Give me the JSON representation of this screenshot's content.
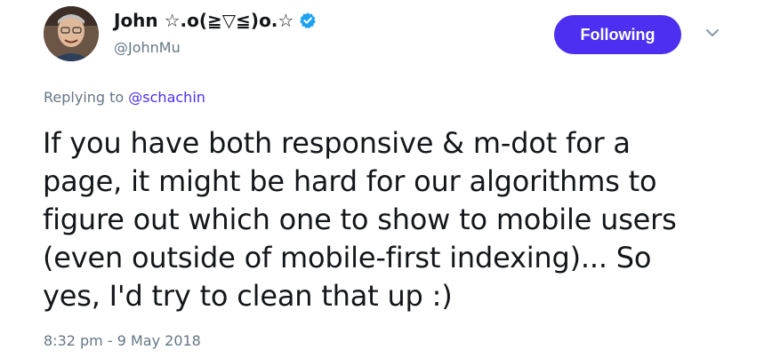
{
  "author": {
    "display_name": "John ☆.o(≧▽≦)o.☆",
    "handle": "@JohnMu",
    "verified": true
  },
  "follow_button": {
    "label": "Following"
  },
  "reply_context": {
    "prefix": "Replying to",
    "handle": "@schachin"
  },
  "tweet": {
    "text_lines": [
      "If you have both responsive & m-dot for a",
      "page, it might be hard for our algorithms to",
      "figure out which one to show to mobile users",
      "(even outside of mobile-first indexing)... So",
      "yes, I'd try to clean that up :)"
    ],
    "timestamp": "8:32 pm - 9 May 2018"
  },
  "colors": {
    "accent": "#4c2ff0",
    "verified_badge": "#1da1f2",
    "secondary_text": "#657786",
    "primary_text": "#14171a"
  },
  "icons": {
    "verified": "verified-badge-icon",
    "menu": "chevron-down-icon"
  }
}
